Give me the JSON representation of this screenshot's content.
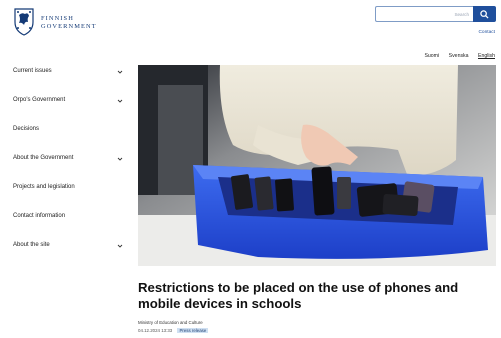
{
  "header": {
    "logo_line1": "FINNISH",
    "logo_line2": "GOVERNMENT",
    "search_placeholder": "Search",
    "contact_label": "Contact",
    "languages": [
      "Suomi",
      "Svenska",
      "English"
    ],
    "active_language": "English"
  },
  "sidebar": {
    "items": [
      {
        "label": "Current issues",
        "has_submenu": true
      },
      {
        "label": "Orpo's Government",
        "has_submenu": true
      },
      {
        "label": "Decisions",
        "has_submenu": false
      },
      {
        "label": "About the Government",
        "has_submenu": true
      },
      {
        "label": "Projects and legislation",
        "has_submenu": false
      },
      {
        "label": "Contact information",
        "has_submenu": false
      },
      {
        "label": "About the site",
        "has_submenu": true
      }
    ]
  },
  "article": {
    "title": "Restrictions to be placed on the use of phones and mobile devices in schools",
    "ministry": "Ministry of Education and Culture",
    "date": "04.12.2024",
    "time": "13:33",
    "tag": "Press release"
  },
  "colors": {
    "brand_blue": "#1f4f9c",
    "logo_blue": "#143a76",
    "tag_bg": "#cfe0f2",
    "box_blue": "#2550e0"
  }
}
